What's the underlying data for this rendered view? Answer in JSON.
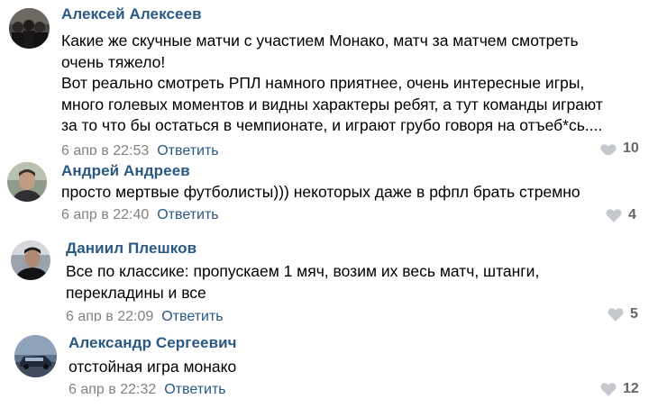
{
  "comments": [
    {
      "author": "Алексей Алексеев",
      "text": [
        "Какие же скучные матчи с участием Монако, матч за матчем смотреть",
        "очень тяжело!",
        "Вот реально смотреть РПЛ намного приятнее, очень интересные игры,",
        "много голевых моментов и видны характеры ребят, а тут команды играют",
        "за то что бы остаться в чемпионате, и играют грубо говоря на отъеб*сь...."
      ],
      "date": "6 апр в 22:53",
      "reply": "Ответить",
      "likes": "10"
    },
    {
      "author": "Андрей Андреев",
      "text": [
        "просто мертвые футболисты))) некоторых даже в рфпл брать стремно"
      ],
      "date": "6 апр в 22:40",
      "reply": "Ответить",
      "likes": "4"
    },
    {
      "author": "Даниил Плешков",
      "text": [
        "Все по классике: пропускаем 1 мяч, возим их весь матч, штанги,",
        "перекладины и все"
      ],
      "date": "6 апр в 22:09",
      "reply": "Ответить",
      "likes": "5"
    },
    {
      "author": "Александр Сергеевич",
      "text": [
        "отстойная игра монако"
      ],
      "date": "6 апр в 22:32",
      "reply": "Ответить",
      "likes": "12"
    }
  ],
  "icons": {
    "like": "heart-icon"
  },
  "colors": {
    "author": "#2a5885",
    "reply": "#2a5885",
    "date": "#828282",
    "likes": "#656565",
    "heart": "#c5c9cf"
  }
}
